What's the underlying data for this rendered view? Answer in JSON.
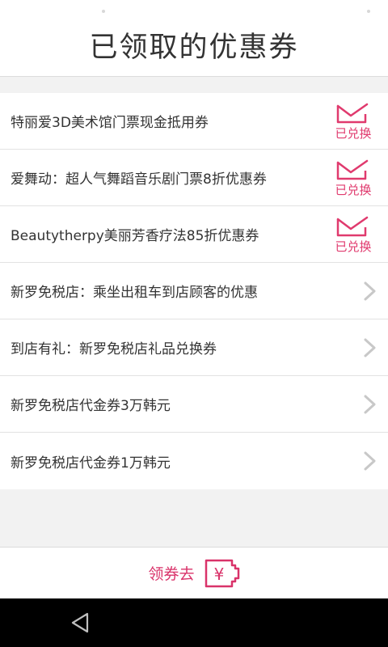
{
  "header": {
    "title": "已领取的优惠券"
  },
  "coupons": [
    {
      "name": "特丽爱3D美术馆门票现金抵用券",
      "status": "已兑换"
    },
    {
      "name": "爱舞动：超人气舞蹈音乐剧门票8折优惠券",
      "status": "已兑换"
    },
    {
      "name": "Beautytherpy美丽芳香疗法85折优惠券",
      "status": "已兑换"
    },
    {
      "name": "新罗免税店：乘坐出租车到店顾客的优惠",
      "status": ""
    },
    {
      "name": "到店有礼：新罗免税店礼品兑换券",
      "status": ""
    },
    {
      "name": "新罗免税店代金券3万韩元",
      "status": ""
    },
    {
      "name": "新罗免税店代金券1万韩元",
      "status": ""
    }
  ],
  "footer": {
    "get_coupon_label": "领券去",
    "ticket_symbol": "¥"
  },
  "icons": {
    "redeemed": "envelope-check-icon",
    "row_action": "chevron-right-icon",
    "ticket": "ticket-icon",
    "back": "back-triangle-icon"
  },
  "colors": {
    "accent": "#e03a6e",
    "chevron": "#c8c8c8",
    "nav": "#000000"
  }
}
